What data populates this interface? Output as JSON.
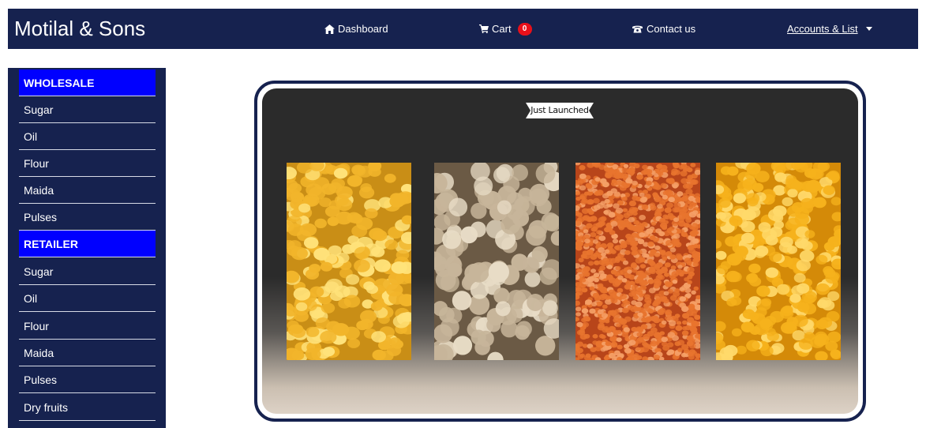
{
  "brand": "Motilal & Sons",
  "nav": {
    "dashboard": "Dashboard",
    "cart": "Cart",
    "cart_count": "0",
    "contact": "Contact us",
    "accounts": "Accounts & List"
  },
  "sidebar": {
    "wholesale": {
      "heading": "WHOLESALE",
      "items": [
        "Sugar",
        "Oil",
        "Flour",
        "Maida",
        "Pulses"
      ]
    },
    "retailer": {
      "heading": "RETAILER",
      "items": [
        "Sugar",
        "Oil",
        "Flour",
        "Maida",
        "Pulses",
        "Dry fruits"
      ]
    }
  },
  "showcase": {
    "ribbon": "Just Launched",
    "products": [
      {
        "name": "chana-dal-image",
        "base": "#c98e16",
        "grain": "#f2b52b",
        "hi": "#ffe27a"
      },
      {
        "name": "chickpea-image",
        "base": "#6b5a45",
        "grain": "#c7b59a",
        "hi": "#e8dcc6"
      },
      {
        "name": "masoor-dal-image",
        "base": "#b8451a",
        "grain": "#e8742e",
        "hi": "#f5a067"
      },
      {
        "name": "toor-dal-image",
        "base": "#d48a08",
        "grain": "#f6b21c",
        "hi": "#ffd96a"
      }
    ]
  },
  "colors": {
    "navbar": "#16224f",
    "sidebar_heading": "#0000ff",
    "badge": "#e8101a"
  }
}
